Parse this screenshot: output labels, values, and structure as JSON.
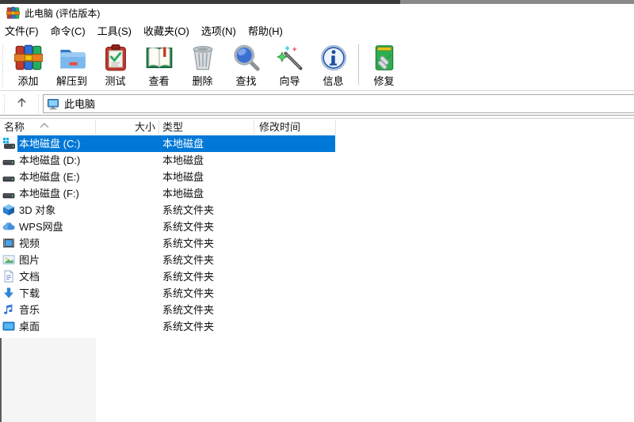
{
  "window": {
    "title": "此电脑 (评估版本)",
    "accent_color": "#0078d7"
  },
  "menu": {
    "items": [
      {
        "id": "file",
        "label": "文件(F)"
      },
      {
        "id": "commands",
        "label": "命令(C)"
      },
      {
        "id": "tools",
        "label": "工具(S)"
      },
      {
        "id": "favorites",
        "label": "收藏夹(O)"
      },
      {
        "id": "options",
        "label": "选项(N)"
      },
      {
        "id": "help",
        "label": "帮助(H)"
      }
    ]
  },
  "toolbar": {
    "buttons": [
      {
        "id": "add",
        "label": "添加",
        "icon": "winrar-archive-icon",
        "separator_before": false
      },
      {
        "id": "extract",
        "label": "解压到",
        "icon": "extract-folder-icon",
        "separator_before": false
      },
      {
        "id": "test",
        "label": "测试",
        "icon": "test-clipboard-icon",
        "separator_before": false
      },
      {
        "id": "view",
        "label": "查看",
        "icon": "view-book-icon",
        "separator_before": false
      },
      {
        "id": "delete",
        "label": "删除",
        "icon": "delete-trash-icon",
        "separator_before": false
      },
      {
        "id": "find",
        "label": "查找",
        "icon": "find-magnifier-icon",
        "separator_before": false
      },
      {
        "id": "wizard",
        "label": "向导",
        "icon": "wizard-wand-icon",
        "separator_before": false
      },
      {
        "id": "info",
        "label": "信息",
        "icon": "info-icon",
        "separator_before": false
      },
      {
        "id": "repair",
        "label": "修复",
        "icon": "repair-icon",
        "separator_before": true
      }
    ]
  },
  "addressbar": {
    "location": "此电脑",
    "location_icon": "computer-icon"
  },
  "list": {
    "columns": [
      {
        "id": "name",
        "label": "名称",
        "sorted": "asc"
      },
      {
        "id": "size",
        "label": "大小",
        "sorted": ""
      },
      {
        "id": "type",
        "label": "类型",
        "sorted": ""
      },
      {
        "id": "modified",
        "label": "修改时间",
        "sorted": ""
      }
    ],
    "rows": [
      {
        "id": "drive-c",
        "name": "本地磁盘 (C:)",
        "size": "",
        "type": "本地磁盘",
        "modified": "",
        "icon": "system-drive-icon",
        "selected": true
      },
      {
        "id": "drive-d",
        "name": "本地磁盘 (D:)",
        "size": "",
        "type": "本地磁盘",
        "modified": "",
        "icon": "drive-icon",
        "selected": false
      },
      {
        "id": "drive-e",
        "name": "本地磁盘 (E:)",
        "size": "",
        "type": "本地磁盘",
        "modified": "",
        "icon": "drive-icon",
        "selected": false
      },
      {
        "id": "drive-f",
        "name": "本地磁盘 (F:)",
        "size": "",
        "type": "本地磁盘",
        "modified": "",
        "icon": "drive-icon",
        "selected": false
      },
      {
        "id": "3d-objects",
        "name": "3D 对象",
        "size": "",
        "type": "系统文件夹",
        "modified": "",
        "icon": "cube-icon",
        "selected": false
      },
      {
        "id": "wps-cloud",
        "name": "WPS网盘",
        "size": "",
        "type": "系统文件夹",
        "modified": "",
        "icon": "cloud-icon",
        "selected": false
      },
      {
        "id": "videos",
        "name": "视频",
        "size": "",
        "type": "系统文件夹",
        "modified": "",
        "icon": "videos-icon",
        "selected": false
      },
      {
        "id": "pictures",
        "name": "图片",
        "size": "",
        "type": "系统文件夹",
        "modified": "",
        "icon": "pictures-icon",
        "selected": false
      },
      {
        "id": "documents",
        "name": "文档",
        "size": "",
        "type": "系统文件夹",
        "modified": "",
        "icon": "documents-icon",
        "selected": false
      },
      {
        "id": "downloads",
        "name": "下载",
        "size": "",
        "type": "系统文件夹",
        "modified": "",
        "icon": "downloads-icon",
        "selected": false
      },
      {
        "id": "music",
        "name": "音乐",
        "size": "",
        "type": "系统文件夹",
        "modified": "",
        "icon": "music-note-icon",
        "selected": false
      },
      {
        "id": "desktop",
        "name": "桌面",
        "size": "",
        "type": "系统文件夹",
        "modified": "",
        "icon": "desktop-icon",
        "selected": false
      }
    ]
  }
}
